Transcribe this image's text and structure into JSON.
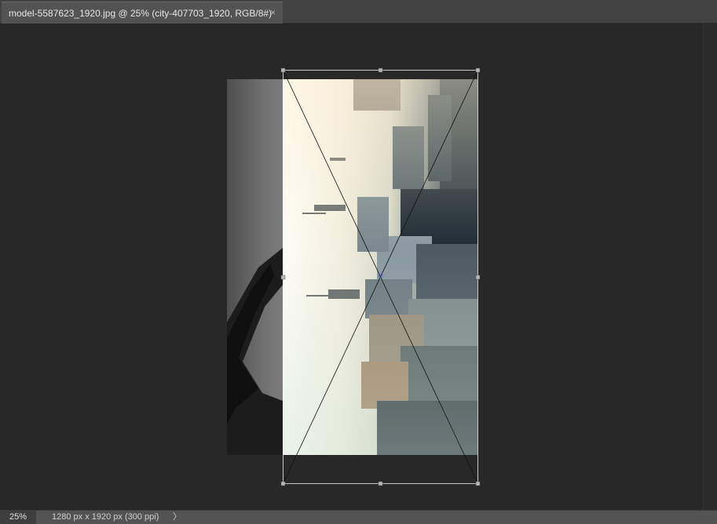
{
  "tab": {
    "title": "model-5587623_1920.jpg @ 25% (city-407703_1920, RGB/8#)",
    "close_glyph": "×"
  },
  "status": {
    "zoom": "25%",
    "doc_info": "1280 px x 1920 px (300 ppi)",
    "arrow": "〉"
  },
  "canvas": {
    "background_color": "#282828",
    "layers": [
      "model-5587623_1920",
      "city-407703_1920"
    ]
  },
  "icons": {
    "tab_close": "close-icon",
    "status_menu": "chevron-right-icon"
  }
}
